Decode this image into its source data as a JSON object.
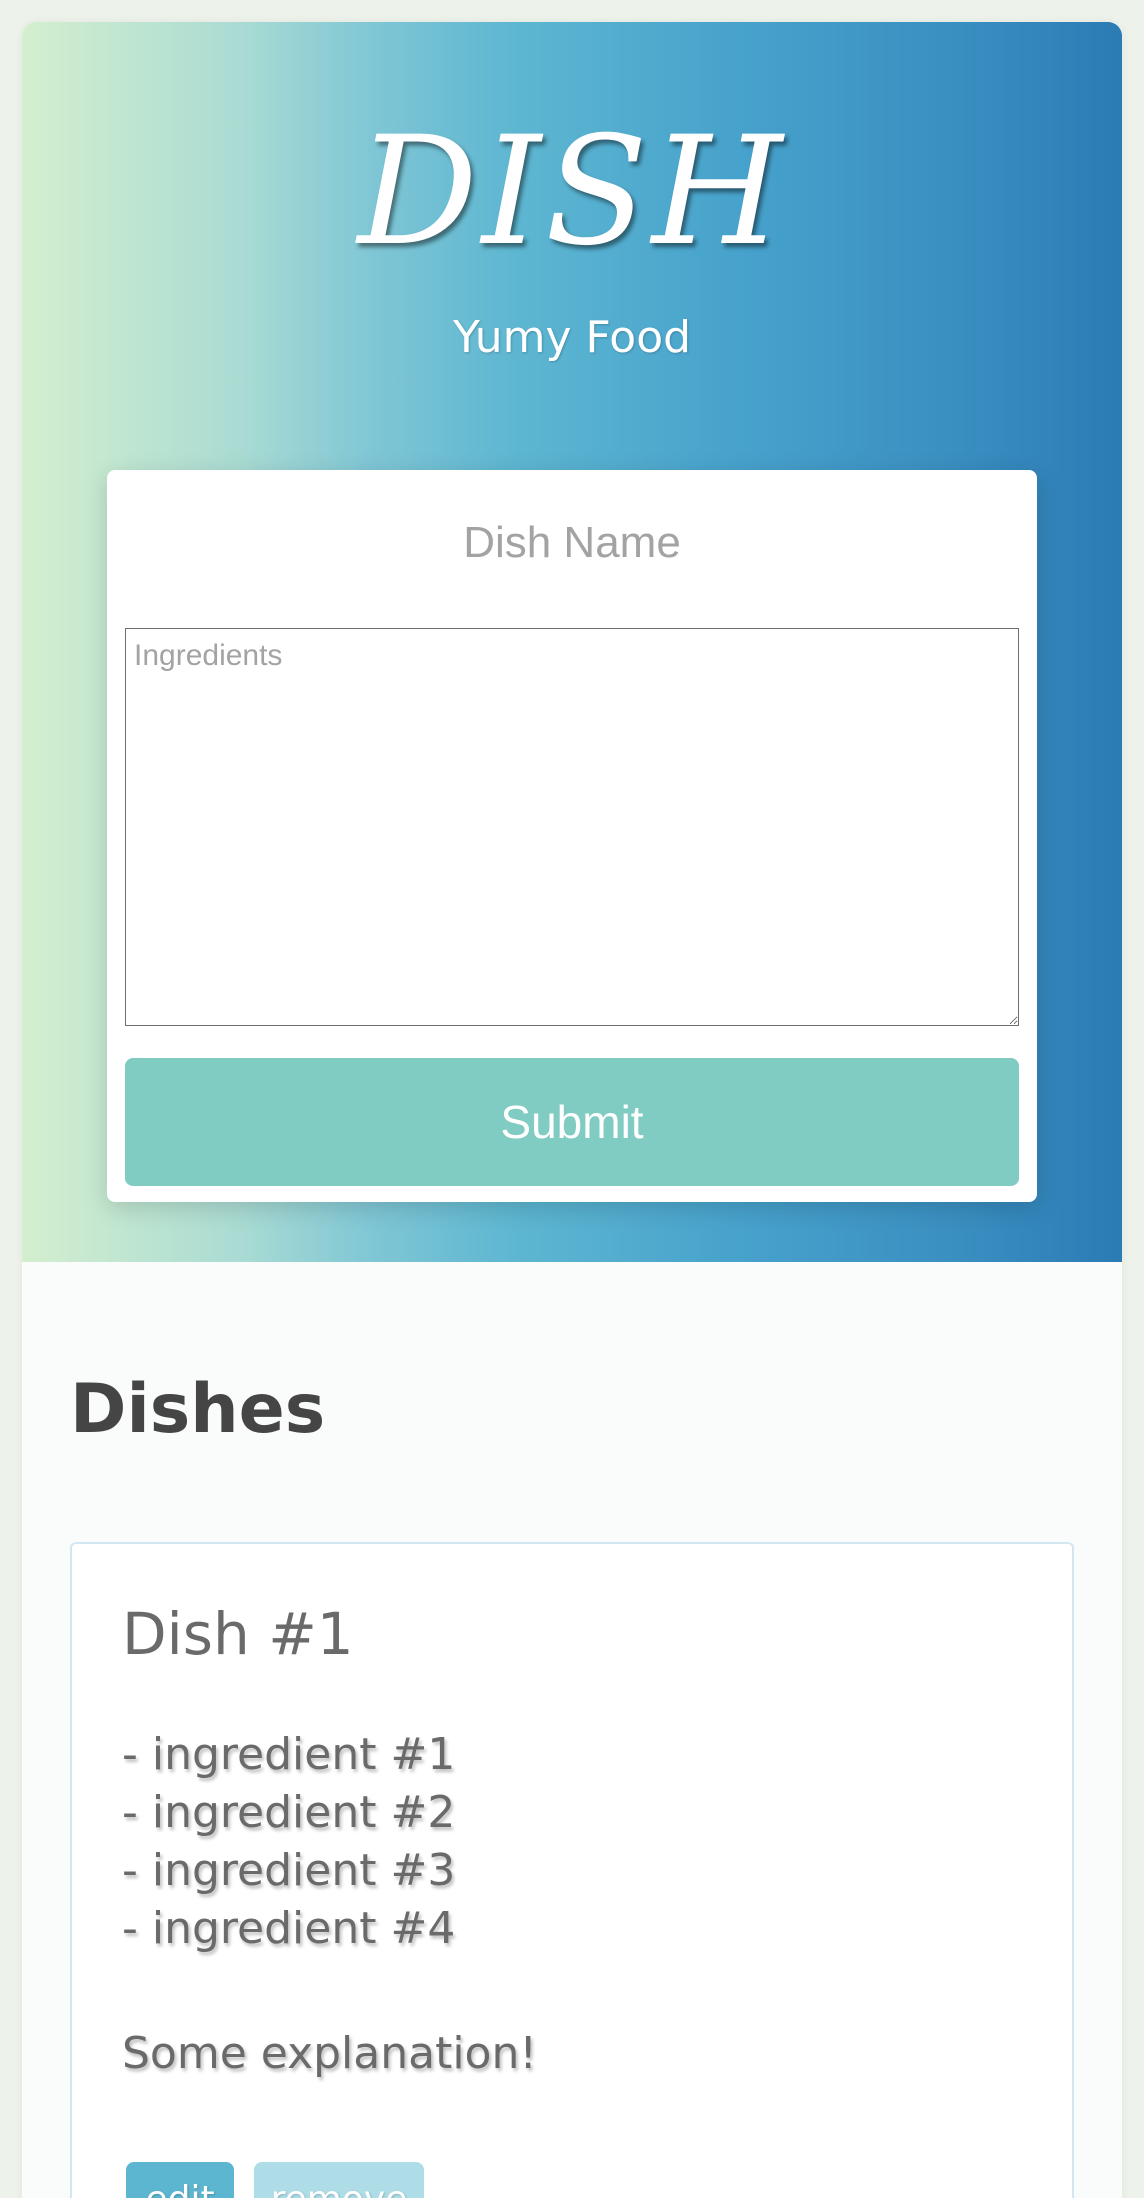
{
  "header": {
    "logo": "DISH",
    "tagline": "Yumy Food"
  },
  "form": {
    "name_placeholder": "Dish Name",
    "ingredients_placeholder": "Ingredients",
    "submit_label": "Submit"
  },
  "dishes": {
    "heading": "Dishes",
    "items": [
      {
        "title": "Dish #1",
        "ingredients": [
          "- ingredient #1",
          "- ingredient #2",
          "- ingredient #3",
          "- ingredient #4"
        ],
        "description": "Some explanation!",
        "edit_label": "edit",
        "remove_label": "remove"
      }
    ]
  },
  "colors": {
    "submit_button": "#80ccc2",
    "edit_button": "#5db6cf",
    "remove_button": "#aedde7",
    "hero_gradient_start": "#d4efcf",
    "hero_gradient_end": "#2b7bb4"
  }
}
